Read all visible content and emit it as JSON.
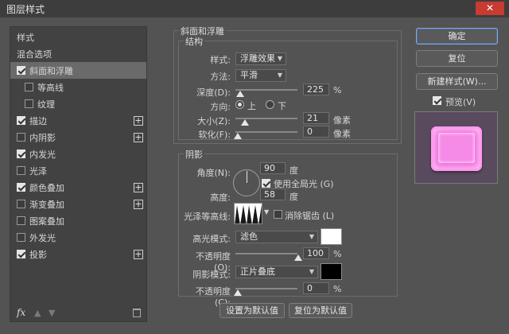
{
  "window": {
    "title": "图层样式",
    "close_icon": "close-icon"
  },
  "left_panel": {
    "header": "样式",
    "blend_options": "混合选项",
    "items": [
      {
        "label": "斜面和浮雕",
        "checked": true,
        "selected": true,
        "plus": false
      },
      {
        "label": "等高线",
        "checked": false,
        "indent": true
      },
      {
        "label": "纹理",
        "checked": false,
        "indent": true
      },
      {
        "label": "描边",
        "checked": true,
        "plus": true
      },
      {
        "label": "内阴影",
        "checked": false,
        "plus": true
      },
      {
        "label": "内发光",
        "checked": true
      },
      {
        "label": "光泽",
        "checked": false
      },
      {
        "label": "颜色叠加",
        "checked": true,
        "plus": true
      },
      {
        "label": "渐变叠加",
        "checked": false,
        "plus": true
      },
      {
        "label": "图案叠加",
        "checked": false
      },
      {
        "label": "外发光",
        "checked": false
      },
      {
        "label": "投影",
        "checked": true,
        "plus": true
      }
    ],
    "fx_label": "fx"
  },
  "bevel": {
    "section_title": "斜面和浮雕",
    "structure_title": "结构",
    "style_label": "样式:",
    "style_value": "浮雕效果",
    "technique_label": "方法:",
    "technique_value": "平滑",
    "depth_label": "深度(D):",
    "depth_value": "225",
    "depth_unit": "%",
    "direction_label": "方向:",
    "direction_up": "上",
    "direction_down": "下",
    "size_label": "大小(Z):",
    "size_value": "21",
    "size_unit": "像素",
    "soften_label": "软化(F):",
    "soften_value": "0",
    "soften_unit": "像素"
  },
  "shading": {
    "title": "阴影",
    "angle_label": "角度(N):",
    "angle_value": "90",
    "angle_unit": "度",
    "global_light_label": "使用全局光 (G)",
    "altitude_label": "高度:",
    "altitude_value": "58",
    "altitude_unit": "度",
    "gloss_contour_label": "光泽等高线:",
    "antialias_label": "消除锯齿 (L)",
    "highlight_mode_label": "高光模式:",
    "highlight_mode_value": "滤色",
    "highlight_color": "#ffffff",
    "highlight_opacity_label": "不透明度(O):",
    "highlight_opacity_value": "100",
    "highlight_opacity_unit": "%",
    "shadow_mode_label": "阴影模式:",
    "shadow_mode_value": "正片叠底",
    "shadow_color": "#000000",
    "shadow_opacity_label": "不透明度(C):",
    "shadow_opacity_value": "0",
    "shadow_opacity_unit": "%"
  },
  "footer_buttons": {
    "make_default": "设置为默认值",
    "reset_default": "复位为默认值"
  },
  "right": {
    "ok": "确定",
    "reset": "复位",
    "new_style": "新建样式(W)...",
    "preview_label": "预览(V)",
    "preview_color": "#f06adf"
  }
}
